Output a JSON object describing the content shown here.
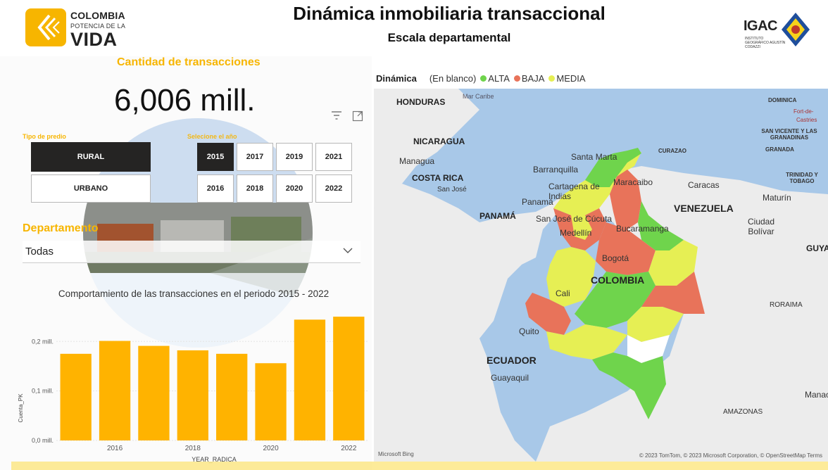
{
  "header": {
    "title": "Dinámica inmobiliaria transaccional",
    "subtitle": "Escala departamental",
    "logo_left": {
      "line1": "COLOMBIA",
      "line2": "POTENCIA DE LA",
      "line3": "VIDA"
    },
    "logo_right": {
      "name": "IGAC",
      "sub": "INSTITUTO GEOGRÁFICO AGUSTÍN CODAZZI"
    }
  },
  "kpi": {
    "title": "Cantidad de transacciones",
    "value": "6,006 mill."
  },
  "slicers": {
    "tipo_label": "Tipo de predio",
    "tipo_options": [
      "RURAL",
      "URBANO"
    ],
    "tipo_selected": "RURAL",
    "year_label": "Selecione el año",
    "years": [
      "2015",
      "2017",
      "2019",
      "2021",
      "2016",
      "2018",
      "2020",
      "2022"
    ],
    "year_selected": "2015"
  },
  "departamento": {
    "label": "Departamento",
    "value": "Todas"
  },
  "chart_data": {
    "type": "bar",
    "title": "Comportamiento de las transacciones en el periodo 2015 - 2022",
    "xlabel": "YEAR_RADICA",
    "ylabel": "Cuenta_PK",
    "categories": [
      2015,
      2016,
      2017,
      2018,
      2019,
      2020,
      2021,
      2022
    ],
    "values": [
      0.175,
      0.201,
      0.191,
      0.182,
      0.175,
      0.156,
      0.244,
      0.25
    ],
    "ylim": [
      0,
      0.27
    ],
    "yticks": [
      "0,0 mill.",
      "0,1 mill.",
      "0,2 mill."
    ],
    "xtick_labels": [
      "2016",
      "2018",
      "2020",
      "2022"
    ],
    "bar_color": "#ffb300"
  },
  "map": {
    "legend_title": "Dinámica",
    "legend_blank": "(En blanco)",
    "legend_items": [
      {
        "label": "ALTA",
        "color": "#6fd44c"
      },
      {
        "label": "BAJA",
        "color": "#e8735a"
      },
      {
        "label": "MEDIA",
        "color": "#e6ef54"
      }
    ],
    "labels": {
      "honduras": "HONDURAS",
      "mar_caribe": "Mar Caribe",
      "nicaragua": "NICARAGUA",
      "managua": "Managua",
      "costa_rica": "COSTA RICA",
      "san_jose": "San José",
      "panama": "PANAMÁ",
      "panama_city": "Panamá",
      "santa_marta": "Santa Marta",
      "barranquilla": "Barranquilla",
      "cartagena": "Cartagena de Indias",
      "maracaibo": "Maracaibo",
      "caracas": "Caracas",
      "curazao": "CURAZAO",
      "venezuela": "VENEZUELA",
      "cucuta": "San José de Cúcuta",
      "medellin": "Medellín",
      "bucaramanga": "Bucaramanga",
      "bogota": "Bogotá",
      "colombia": "COLOMBIA",
      "cali": "Cali",
      "quito": "Quito",
      "ecuador": "ECUADOR",
      "guayaquil": "Guayaquil",
      "ciudad_bolivar": "Ciudad Bolívar",
      "maturin": "Maturín",
      "roraima": "RORAIMA",
      "guya": "GUYA",
      "manaos": "Manao",
      "amazonas": "AMAZONAS",
      "dominica": "DOMINICA",
      "fort": "Fort-de-",
      "castries": "Castries",
      "san_vicente": "SAN VICENTE Y LAS GRANADINAS",
      "granada": "GRANADA",
      "trinidad": "TRINIDAD Y TOBAGO"
    },
    "credit": "© 2023 TomTom, © 2023 Microsoft Corporation, © OpenStreetMap  Terms",
    "bing": "Microsoft Bing"
  },
  "colors": {
    "accent": "#f7b500",
    "alta": "#6fd44c",
    "baja": "#e8735a",
    "media": "#e6ef54"
  }
}
